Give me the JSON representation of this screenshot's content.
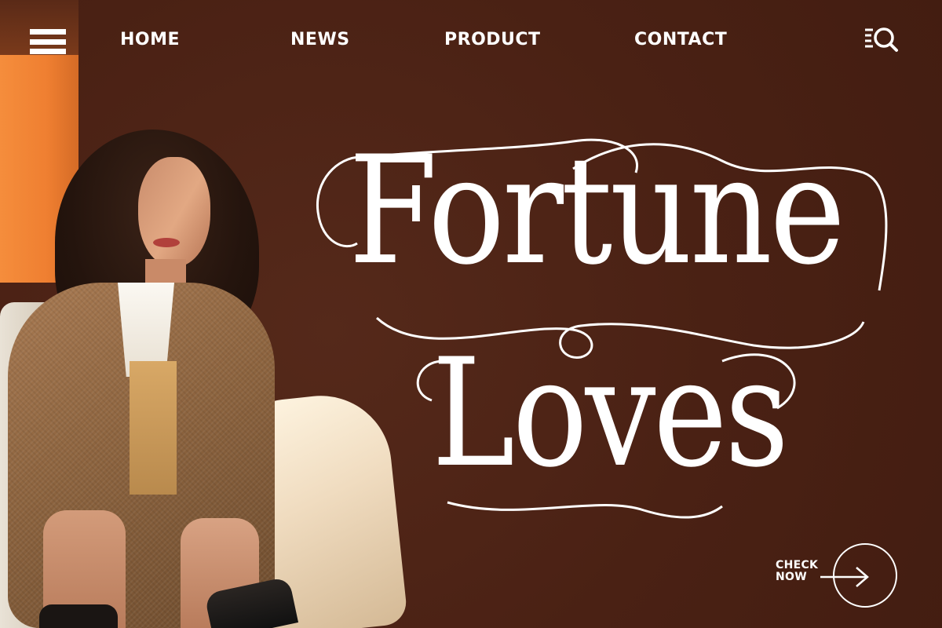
{
  "nav": {
    "menu_icon": "hamburger-menu-icon",
    "items": [
      {
        "label": "HOME"
      },
      {
        "label": "NEWS"
      },
      {
        "label": "PRODUCT"
      },
      {
        "label": "CONTACT"
      }
    ],
    "search_icon": "list-search-icon"
  },
  "hero": {
    "headline_line1": "Fortune",
    "headline_line2": "Loves",
    "photo": "woman-in-checked-blazer-on-sofa"
  },
  "cta": {
    "line1": "CHECK",
    "line2": "NOW",
    "icon": "arrow-right-icon"
  },
  "colors": {
    "background": "#4a2114",
    "text": "#ffffff",
    "accent_light": "#f58d3c"
  }
}
